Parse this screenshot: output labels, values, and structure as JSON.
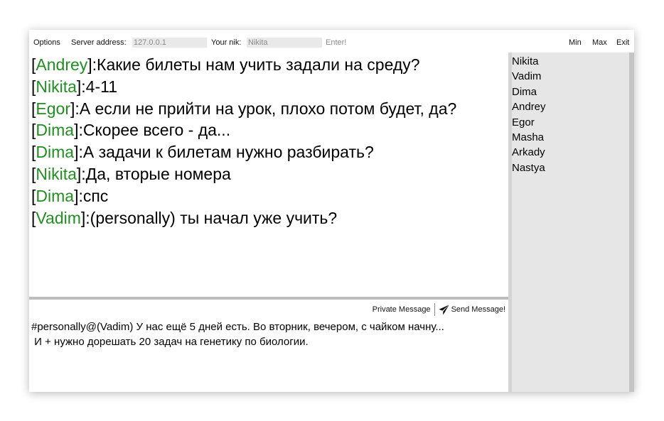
{
  "toolbar": {
    "options": "Options",
    "server_label": "Server address:",
    "server_value": "127.0.0.1",
    "nick_label": "Your nik:",
    "nick_value": "Nikita",
    "enter": "Enter!",
    "min": "Min",
    "max": "Max",
    "exit": "Exit"
  },
  "messages": [
    {
      "nick": "Andrey",
      "text": ":Какие билеты нам учить задали на среду?"
    },
    {
      "nick": "Nikita",
      "text": ":4-11"
    },
    {
      "nick": "Egor",
      "text": ":А если не прийти на урок, плохо потом будет, да?"
    },
    {
      "nick": "Dima",
      "text": ":Скорее всего - да..."
    },
    {
      "nick": "Dima",
      "text": ":А задачи к билетам нужно разбирать?"
    },
    {
      "nick": "Nikita",
      "text": ":Да, вторые номера"
    },
    {
      "nick": "Dima",
      "text": ":спс"
    },
    {
      "nick": "Vadim",
      "text": ":(personally) ты начал уже учить?"
    }
  ],
  "composer": {
    "private_message": "Private Message",
    "send_message": "Send Message!",
    "draft_line1": "#personally@(Vadim) У нас ещё 5 дней есть. Во вторник, вечером, с чайком начну...",
    "draft_line2": " И + нужно дорешать 20 задач на генетику по биологии."
  },
  "users": [
    "Nikita",
    "Vadim",
    "Dima",
    "Andrey",
    "Egor",
    "Masha",
    "Arkady",
    "Nastya"
  ],
  "colors": {
    "nick": "#1f8f1f",
    "user_panel_bg": "#e6e6e6"
  },
  "icons": {
    "send": "paper-plane-icon"
  }
}
